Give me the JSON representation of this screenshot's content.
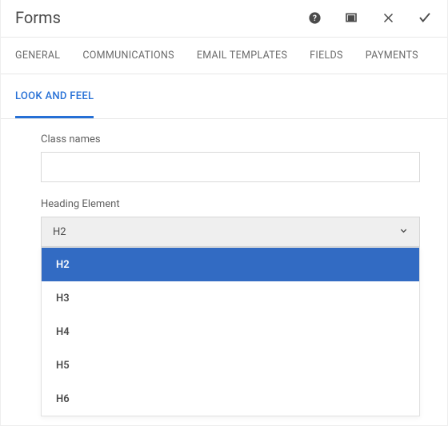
{
  "header": {
    "title": "Forms"
  },
  "tabs": {
    "items": [
      "GENERAL",
      "COMMUNICATIONS",
      "EMAIL TEMPLATES",
      "FIELDS",
      "PAYMENTS"
    ]
  },
  "subtabs": {
    "active": "LOOK AND FEEL"
  },
  "fields": {
    "classNames": {
      "label": "Class names",
      "value": ""
    },
    "headingElement": {
      "label": "Heading Element",
      "selected": "H2",
      "options": [
        "H2",
        "H3",
        "H4",
        "H5",
        "H6"
      ]
    }
  }
}
